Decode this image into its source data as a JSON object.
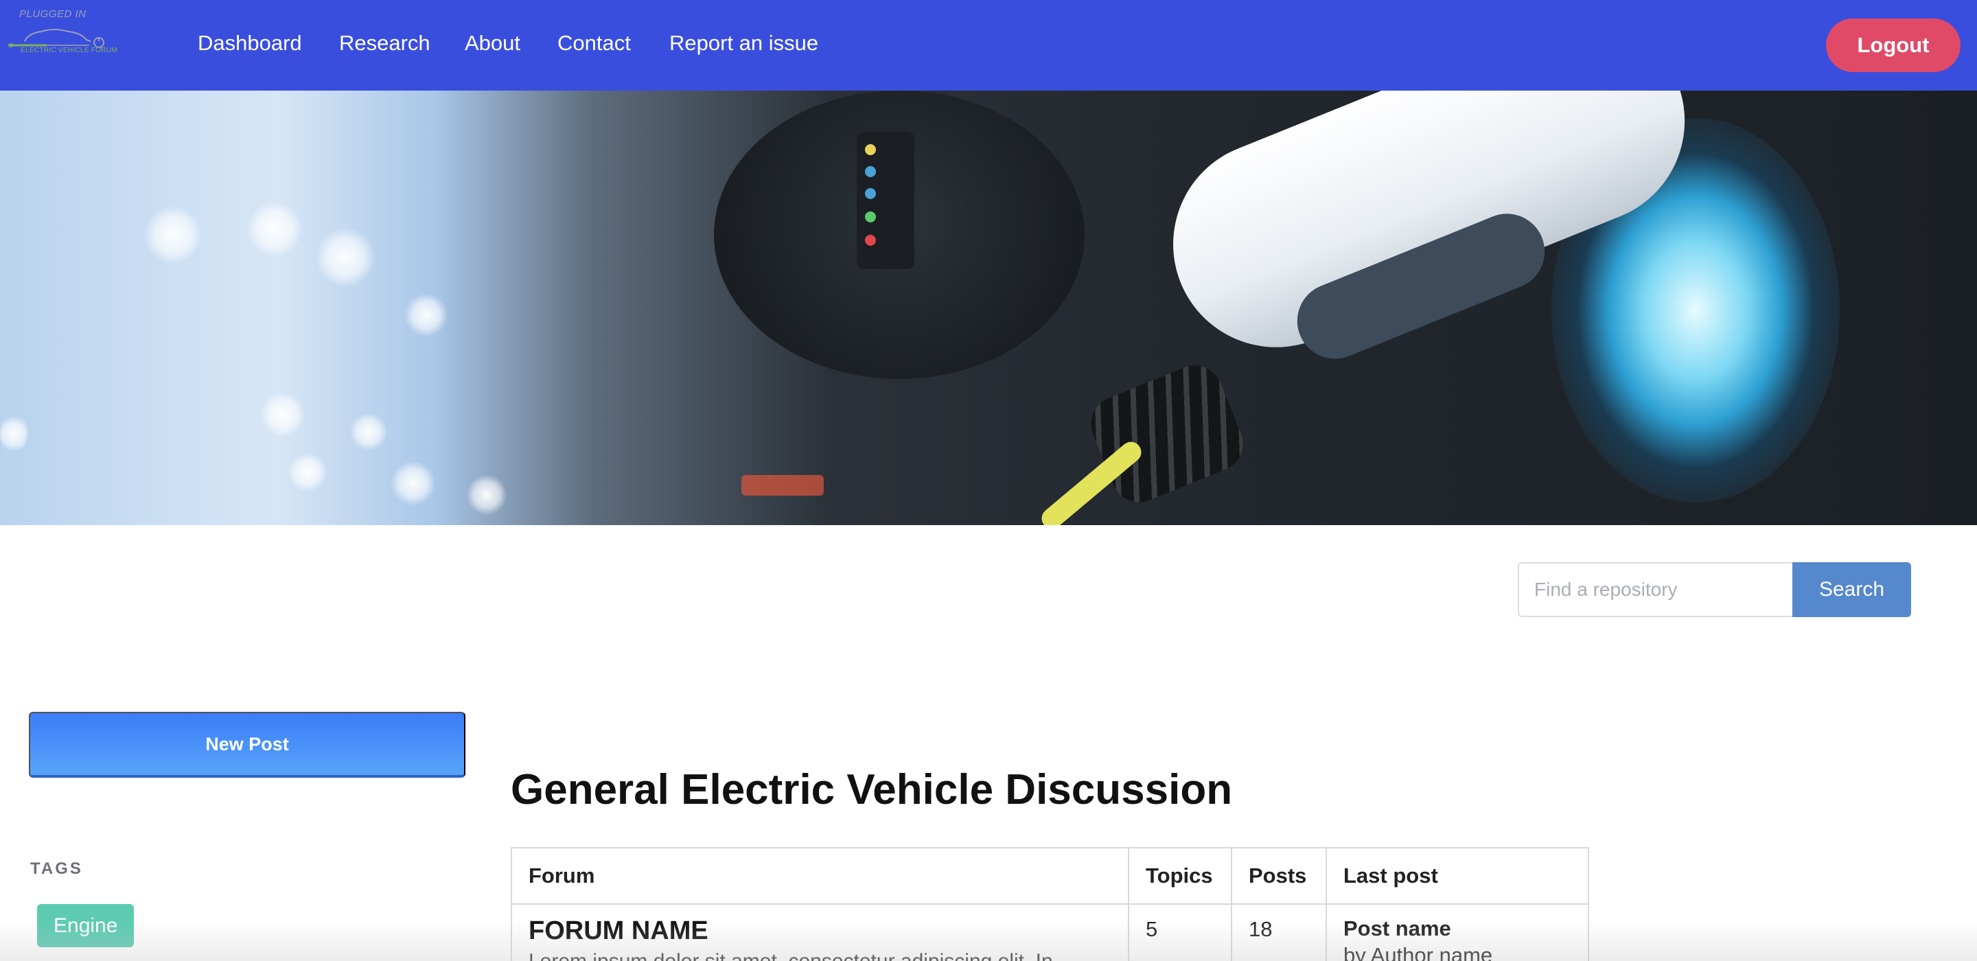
{
  "brand": {
    "logo_top": "PLUGGED IN",
    "logo_bottom": "ELECTRIC VEHICLE FORUM",
    "accent": "#3a4ede"
  },
  "nav": {
    "links": [
      "Dashboard",
      "Research",
      "About",
      "Contact",
      "Report an issue"
    ],
    "logout_label": "Logout"
  },
  "hero": {
    "image": "ev-charging-plug-photo"
  },
  "search": {
    "placeholder": "Find a repository",
    "value": "",
    "button_label": "Search"
  },
  "sidebar": {
    "new_post_label": "New Post",
    "tags_title": "TAGS",
    "tags": [
      "Engine"
    ]
  },
  "main": {
    "heading": "General Electric Vehicle Discussion",
    "table": {
      "headers": [
        "Forum",
        "Topics",
        "Posts",
        "Last post"
      ],
      "rows": [
        {
          "forum_name": "FORUM NAME",
          "forum_desc": "Lorem ipsum dolor sit amet, consectetur adipiscing elit. In",
          "topics": "5",
          "posts": "18",
          "last_post_name": "Post name",
          "last_post_author": "by Author name"
        }
      ]
    }
  },
  "colors": {
    "logout": "#e04a67",
    "search_button": "#5588cc",
    "new_post": "#3b7df8",
    "tag": "#5ccbb2"
  }
}
